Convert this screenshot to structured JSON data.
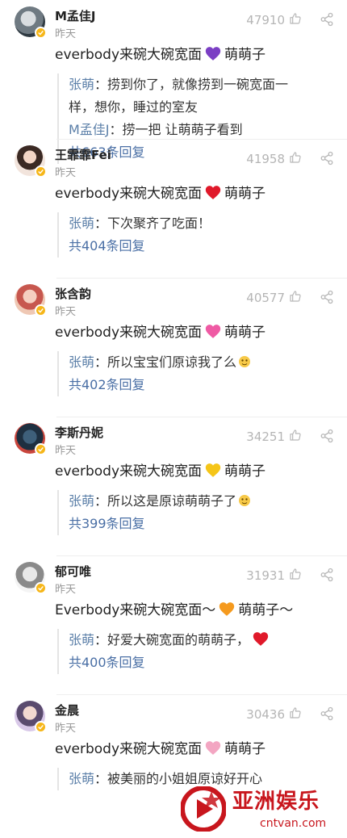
{
  "colors": {
    "username": "#222222",
    "reply_user": "#5b7fa8",
    "more_link": "#4a6fa5",
    "meta": "#999999",
    "badge": "#f6b619",
    "watermark": "#c8161d"
  },
  "comments": [
    {
      "username": "M孟佳J",
      "time": "昨天",
      "likes": "47910",
      "content_before": "everbody来碗大碗宽面",
      "heart_color": "#7b3fc4",
      "content_after": "萌萌子",
      "replies": [
        {
          "user": "张萌",
          "sep": "：",
          "text": "捞到你了，就像捞到一碗宽面一"
        },
        {
          "user": "",
          "sep": "",
          "text": "样，想你，睡过的室友"
        },
        {
          "user": "M孟佳J",
          "sep": "：",
          "text": "捞一把 让萌萌子看到"
        }
      ],
      "more": "共663条回复",
      "avatar_icon": "avatar-icon"
    },
    {
      "username": "王霏霏Fei",
      "time": "昨天",
      "likes": "41958",
      "content_before": "everbody来碗大碗宽面",
      "heart_color": "#e0192a",
      "content_after": "萌萌子",
      "replies": [
        {
          "user": "张萌",
          "sep": "：",
          "text": "下次聚齐了吃面！"
        }
      ],
      "more": "共404条回复",
      "avatar_icon": "avatar-icon"
    },
    {
      "username": "张含韵",
      "time": "昨天",
      "likes": "40577",
      "content_before": "everbody来碗大碗宽面",
      "heart_color": "#ef5aa4",
      "content_after": "萌萌子",
      "replies": [
        {
          "user": "张萌",
          "sep": "：",
          "text": "所以宝宝们原谅我了么"
        }
      ],
      "more": "共402条回复",
      "avatar_icon": "avatar-icon"
    },
    {
      "username": "李斯丹妮",
      "time": "昨天",
      "likes": "34251",
      "content_before": "everbody来碗大碗宽面",
      "heart_color": "#f5c518",
      "content_after": "萌萌子",
      "replies": [
        {
          "user": "张萌",
          "sep": "：",
          "text": "所以这是原谅萌萌子了"
        }
      ],
      "more": "共399条回复",
      "avatar_icon": "avatar-icon"
    },
    {
      "username": "郁可唯",
      "time": "昨天",
      "likes": "31931",
      "content_before": "Everbody来碗大碗宽面～",
      "heart_color": "#f59a1e",
      "content_after": "萌萌子～",
      "replies": [
        {
          "user": "张萌",
          "sep": "：",
          "text": "好爱大碗宽面的萌萌子，"
        }
      ],
      "more": "共400条回复",
      "avatar_icon": "avatar-icon"
    },
    {
      "username": "金晨",
      "time": "昨天",
      "likes": "30436",
      "content_before": "everbody来碗大碗宽面",
      "heart_color": "#f3a6c2",
      "content_after": "萌萌子",
      "replies": [
        {
          "user": "张萌",
          "sep": "：",
          "text": "被美丽的小姐姐原谅好开心"
        }
      ],
      "more": "",
      "avatar_icon": "avatar-icon"
    }
  ],
  "watermark": {
    "title": "亚洲娱乐",
    "domain": "cntvan.com"
  },
  "icons": {
    "like": "thumbs-up-icon",
    "share": "share-icon",
    "verified": "verified-badge-icon"
  }
}
